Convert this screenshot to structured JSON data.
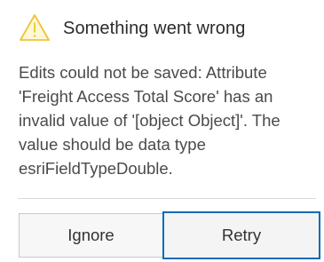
{
  "dialog": {
    "title": "Something went wrong",
    "icon": "warning-triangle-icon",
    "message": "Edits could not be saved: Attribute 'Freight Access Total Score' has an invalid value of '[object Object]'. The value should be data type esriFieldTypeDouble.",
    "colors": {
      "warning_icon": "#f1c232",
      "focus_border": "#0a6ab8",
      "divider": "#d9d9d9"
    }
  },
  "buttons": {
    "ignore_label": "Ignore",
    "retry_label": "Retry"
  }
}
